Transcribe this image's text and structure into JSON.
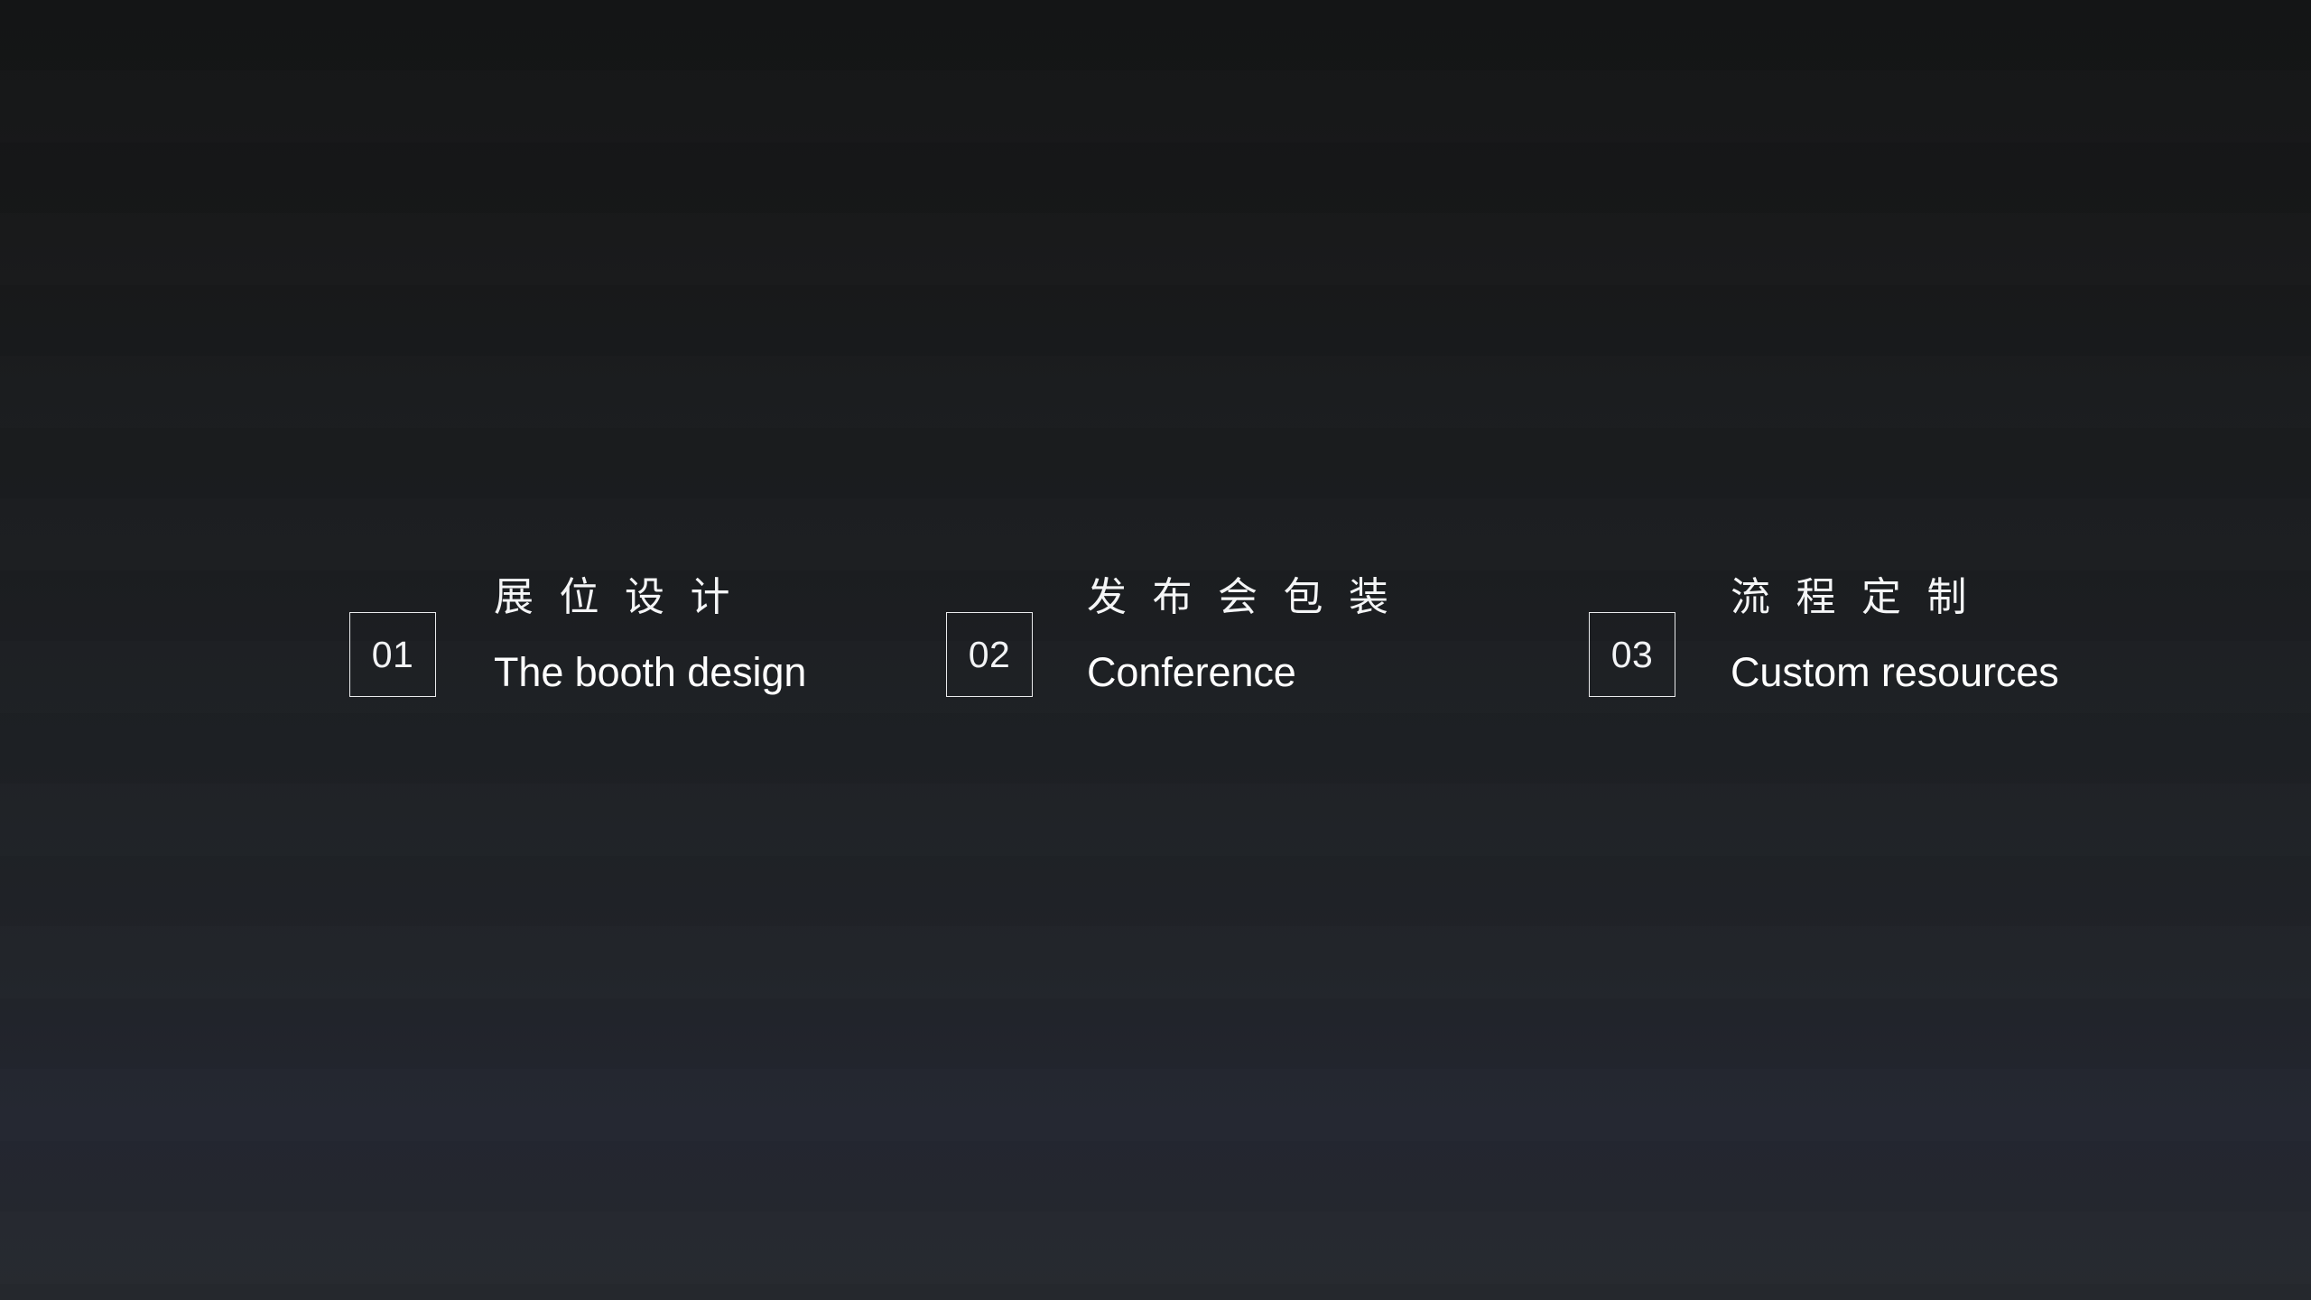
{
  "slide": {
    "background": {
      "top_color": "#141516",
      "mid_color": "#1d2024",
      "bottom_color": "#25282d",
      "style": "vertical-gradient"
    },
    "accent_color": "#ffffff",
    "text_color": "#f4f5f6",
    "border_color": "#e9eaec"
  },
  "items": [
    {
      "number": "01",
      "title_cn": "展 位 设 计",
      "subtitle_en": "The booth design"
    },
    {
      "number": "02",
      "title_cn": "发 布 会 包 装",
      "subtitle_en": "Conference"
    },
    {
      "number": "03",
      "title_cn": "流 程 定 制",
      "subtitle_en": "Custom resources"
    }
  ]
}
